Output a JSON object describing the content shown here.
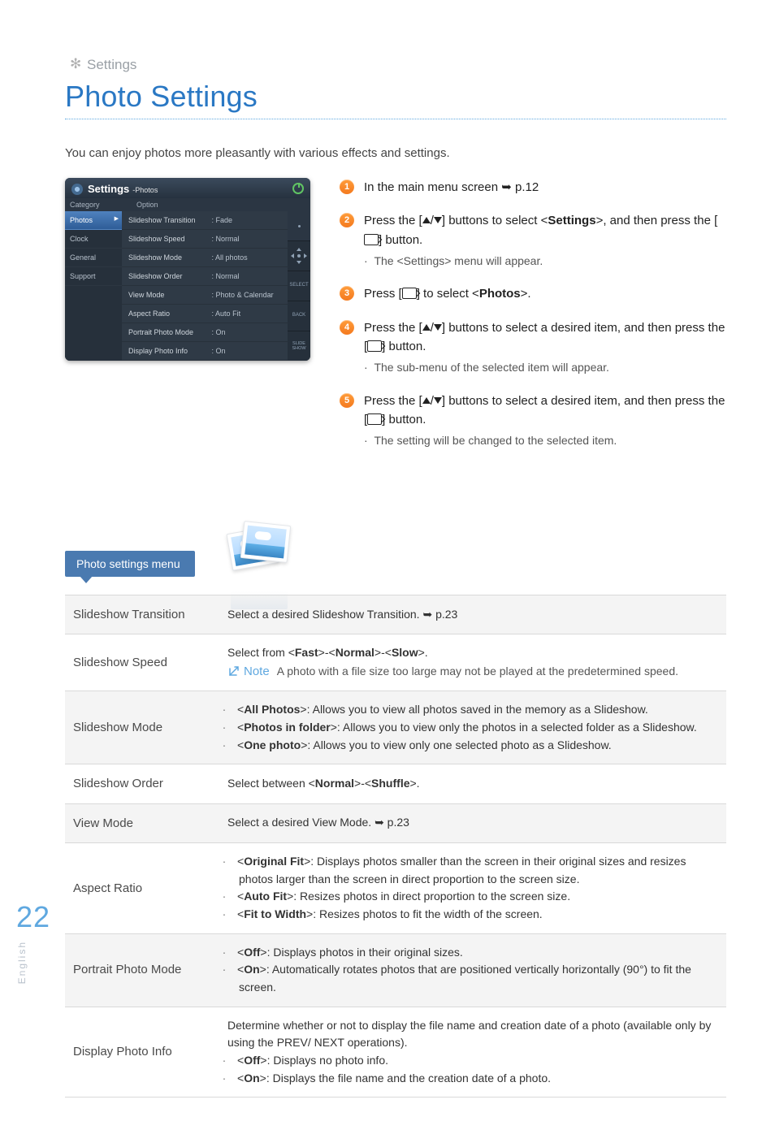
{
  "breadcrumb": "Settings",
  "title": "Photo Settings",
  "intro": "You can enjoy photos more pleasantly with various effects and settings.",
  "device": {
    "title": "Settings",
    "subtitle": "-Photos",
    "head": {
      "c1": "Category",
      "c2": "Option"
    },
    "cats": [
      "Photos",
      "Clock",
      "General",
      "Support"
    ],
    "activeCat": 0,
    "opts": [
      {
        "k": "Slideshow Transition",
        "v": ": Fade"
      },
      {
        "k": "Slideshow Speed",
        "v": ": Normal"
      },
      {
        "k": "Slideshow Mode",
        "v": ": All photos"
      },
      {
        "k": "Slideshow Order",
        "v": ": Normal"
      },
      {
        "k": "View Mode",
        "v": ": Photo & Calendar"
      },
      {
        "k": "Aspect Ratio",
        "v": ": Auto Fit"
      },
      {
        "k": "Portrait Photo Mode",
        "v": ": On"
      },
      {
        "k": "Display Photo Info",
        "v": ": On"
      }
    ],
    "side": {
      "select": "SELECT",
      "back": "BACK",
      "slideshow": "SLIDE\nSHOW"
    }
  },
  "steps": {
    "s1": {
      "a": "In the main menu screen ➥ p.12"
    },
    "s2": {
      "a": "Press the [",
      "b": "] buttons to select <",
      "c": "Settings",
      "d": ">, and then press the [",
      "e": "] button.",
      "sub": "The <Settings> menu will appear."
    },
    "s3": {
      "a": "Press [",
      "b": "] to select <",
      "c": "Photos",
      "d": ">."
    },
    "s4": {
      "a": "Press the [",
      "b": "] buttons to select a desired item, and then press the [",
      "c": "] button.",
      "sub": "The sub-menu of the selected item will appear."
    },
    "s5": {
      "a": "Press the [",
      "b": "] buttons to select a desired item, and then press the [",
      "c": "] button.",
      "sub": "The setting will be changed to the selected item."
    }
  },
  "section_tab": "Photo settings menu",
  "table": {
    "rows": [
      {
        "key": "Slideshow Transition",
        "plain": "Select a desired Slideshow Transition. ➥ p.23"
      },
      {
        "key": "Slideshow Speed",
        "plain": "Select from <Fast>-<Normal>-<Slow>.",
        "note": "A photo with a file size too large may not be played at the predetermined speed."
      },
      {
        "key": "Slideshow Mode",
        "opts": [
          {
            "lead": "<All Photos>",
            "rest": ": Allows you to view all photos saved in the memory as a Slideshow."
          },
          {
            "lead": "<Photos in folder>",
            "rest": ": Allows you to view only the photos in a selected folder as a Slideshow."
          },
          {
            "lead": "<One photo>",
            "rest": ": Allows you to view only one selected photo as a Slideshow."
          }
        ]
      },
      {
        "key": "Slideshow Order",
        "plain": "Select between <Normal>-<Shuffle>."
      },
      {
        "key": "View Mode",
        "plain": "Select a desired View Mode. ➥ p.23"
      },
      {
        "key": "Aspect Ratio",
        "opts": [
          {
            "lead": "<Original Fit>",
            "rest": ": Displays photos smaller than the screen in their original sizes and resizes photos larger than the screen in direct proportion to the screen size."
          },
          {
            "lead": "<Auto Fit>",
            "rest": ": Resizes photos in direct proportion to the screen size."
          },
          {
            "lead": "<Fit to Width>",
            "rest": ": Resizes photos to fit the width of the screen."
          }
        ]
      },
      {
        "key": "Portrait Photo Mode",
        "opts": [
          {
            "lead": "<Off>",
            "rest": ": Displays photos in their original sizes."
          },
          {
            "lead": "<On>",
            "rest": ": Automatically rotates photos that are positioned vertically horizontally (90°) to fit the screen."
          }
        ]
      },
      {
        "key": "Display Photo Info",
        "pre": "Determine whether or not to display the file name and creation date of a photo (available only by using the PREV/ NEXT operations).",
        "opts": [
          {
            "lead": "<Off>",
            "rest": ": Displays no photo info."
          },
          {
            "lead": "<On>",
            "rest": ": Displays the file name and the creation date of a photo."
          }
        ]
      }
    ]
  },
  "page_number": "22",
  "language": "English",
  "note_label": "Note"
}
